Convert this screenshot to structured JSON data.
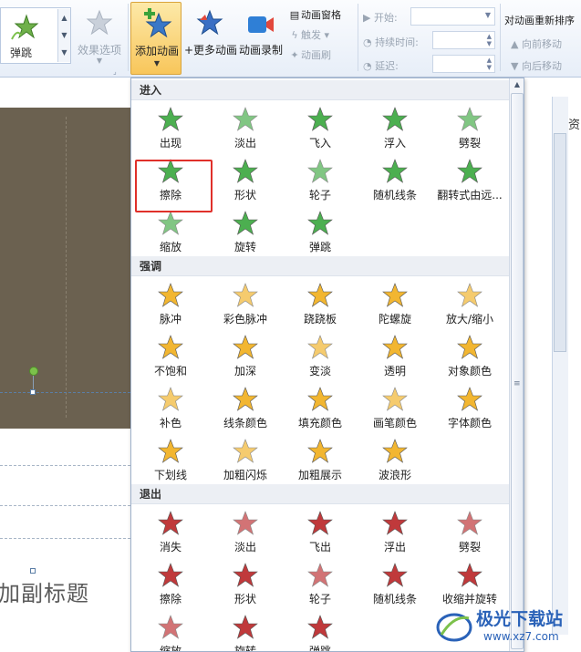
{
  "ribbon": {
    "gallery_label": "弹跳",
    "effect_options": "效果选项",
    "add_animation": "添加动画",
    "more_animations": "+更多动画",
    "record_animation": "动画录制",
    "animation_pane": "动画窗格",
    "trigger": "触发",
    "animation_brush": "动画刷",
    "start_label": "开始:",
    "duration_label": "持续时间:",
    "delay_label": "延迟:",
    "reorder_title": "对动画重新排序",
    "move_earlier": "向前移动",
    "move_later": "向后移动"
  },
  "slide": {
    "subtitle": "加副标题"
  },
  "right_panel": {
    "text": "资"
  },
  "dropdown": {
    "sections": [
      {
        "title": "进入",
        "color": "#4caf50",
        "items": [
          "出现",
          "淡出",
          "飞入",
          "浮入",
          "劈裂",
          "擦除",
          "形状",
          "轮子",
          "随机线条",
          "翻转式由远...",
          "缩放",
          "旋转",
          "弹跳"
        ]
      },
      {
        "title": "强调",
        "color": "#f2b631",
        "items": [
          "脉冲",
          "彩色脉冲",
          "跷跷板",
          "陀螺旋",
          "放大/缩小",
          "不饱和",
          "加深",
          "变淡",
          "透明",
          "对象颜色",
          "补色",
          "线条颜色",
          "填充颜色",
          "画笔颜色",
          "字体颜色",
          "下划线",
          "加粗闪烁",
          "加粗展示",
          "波浪形"
        ]
      },
      {
        "title": "退出",
        "color": "#c0393b",
        "items": [
          "消失",
          "淡出",
          "飞出",
          "浮出",
          "劈裂",
          "擦除",
          "形状",
          "轮子",
          "随机线条",
          "收缩并旋转",
          "缩放",
          "旋转",
          "弹跳"
        ]
      }
    ],
    "highlighted_item": "擦除"
  },
  "watermark": {
    "site_name": "极光下载站",
    "url": "www.xz7.com"
  }
}
